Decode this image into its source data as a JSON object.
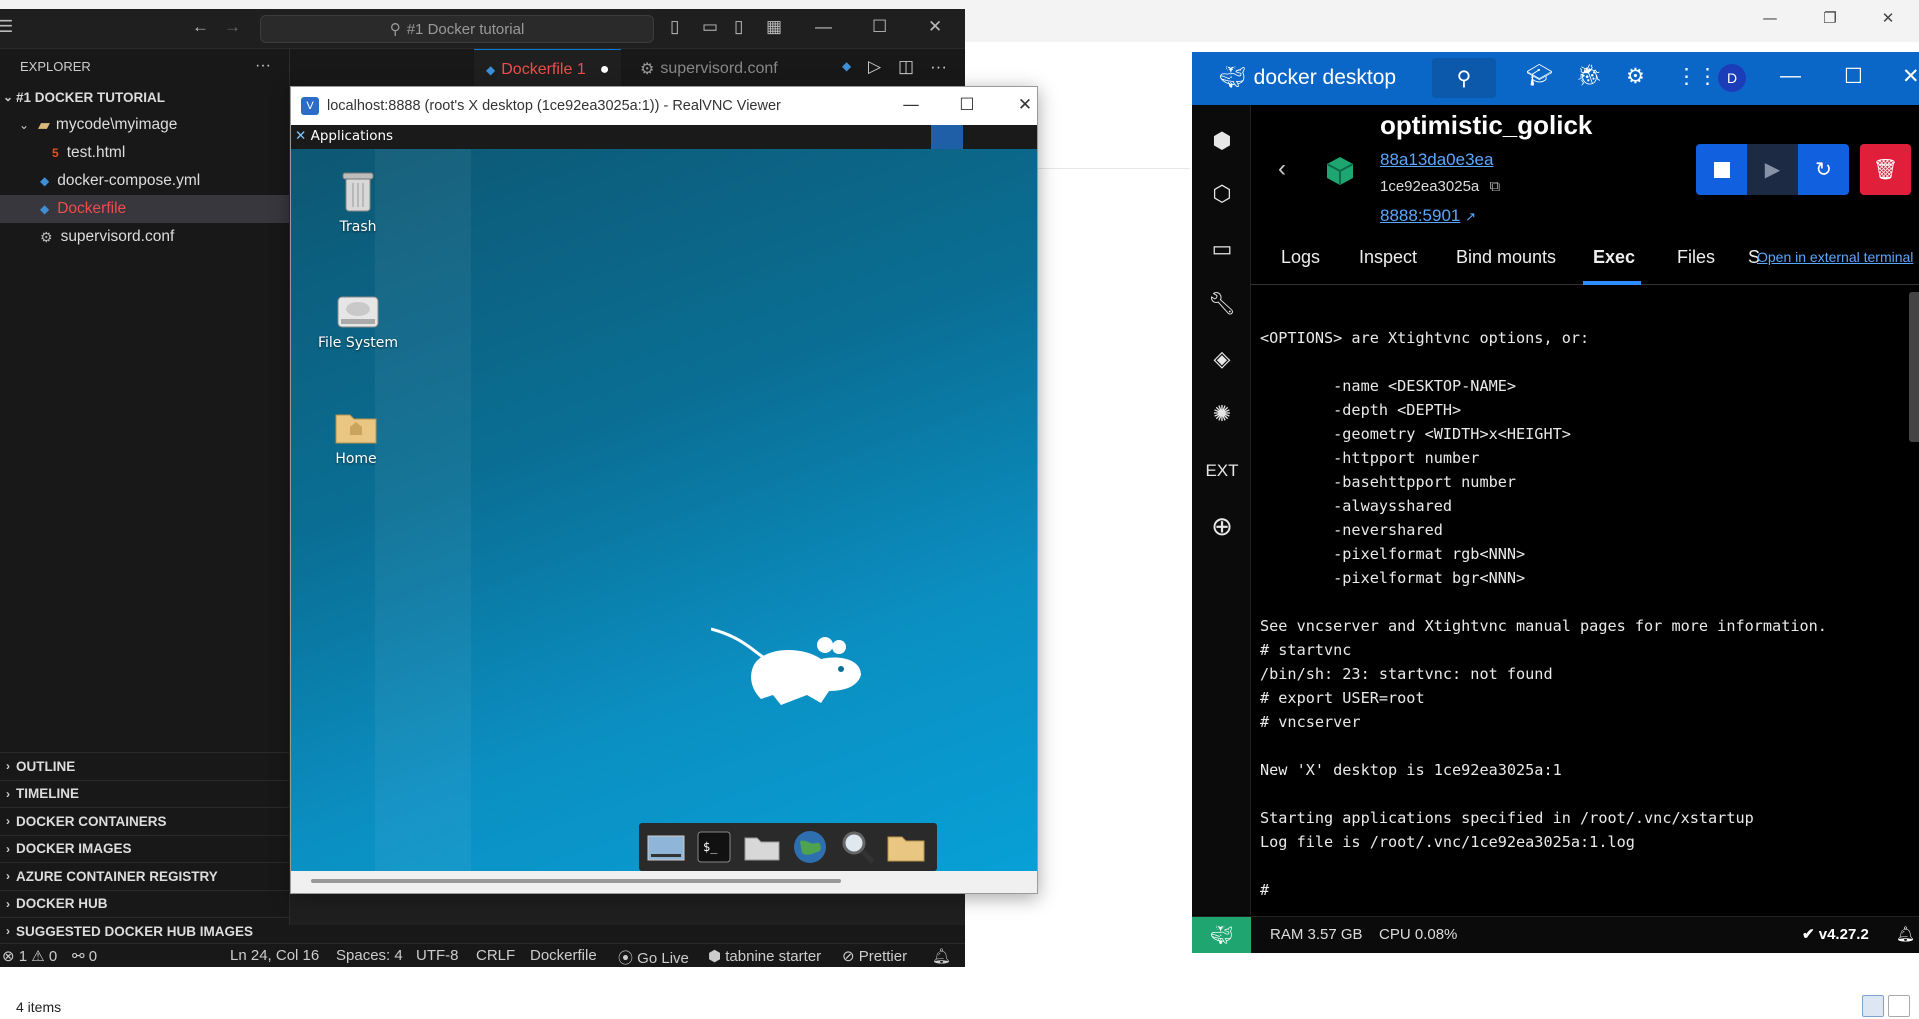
{
  "explorer_bg": {
    "status": "4 items"
  },
  "vscode": {
    "search_placeholder": "#1 Docker tutorial",
    "sidebar_title": "EXPLORER",
    "more": "···",
    "workspace": "#1 DOCKER TUTORIAL",
    "tree": [
      {
        "label": "mycode\\myimage",
        "kind": "folder"
      },
      {
        "label": "test.html",
        "kind": "html"
      },
      {
        "label": "docker-compose.yml",
        "kind": "docker"
      },
      {
        "label": "Dockerfile",
        "kind": "docker"
      },
      {
        "label": "supervisord.conf",
        "kind": "gear"
      }
    ],
    "sections": [
      "OUTLINE",
      "TIMELINE",
      "DOCKER CONTAINERS",
      "DOCKER IMAGES",
      "AZURE CONTAINER REGISTRY",
      "DOCKER HUB",
      "SUGGESTED DOCKER HUB IMAGES"
    ],
    "tabs": [
      {
        "label": "Dockerfile 1"
      },
      {
        "label": "supervisord.conf"
      }
    ],
    "status": {
      "errors": "1",
      "warnings": "0",
      "ports": "0",
      "position": "Ln 24, Col 16",
      "spaces": "Spaces: 4",
      "encoding": "UTF-8",
      "eol": "CRLF",
      "language": "Dockerfile",
      "golive": "Go Live",
      "tabnine": "tabnine starter",
      "prettier": "Prettier"
    }
  },
  "vnc": {
    "title": "localhost:8888 (root's X desktop (1ce92ea3025a:1)) - RealVNC Viewer",
    "applications": "Applications",
    "desktop_icons": [
      "Trash",
      "File System",
      "Home"
    ]
  },
  "docker": {
    "brand": "docker desktop",
    "avatar": "D",
    "ext": "EXT",
    "container_name": "optimistic_golick",
    "image_link": "88a13da0e3ea",
    "container_id": "1ce92ea3025a",
    "port_link": "8888:5901",
    "tabs": [
      "Logs",
      "Inspect",
      "Bind mounts",
      "Exec",
      "Files",
      "S"
    ],
    "external_link": "Open in external terminal",
    "terminal_lines": [
      "<OPTIONS> are Xtightvnc options, or:",
      "",
      "        -name <DESKTOP-NAME>",
      "        -depth <DEPTH>",
      "        -geometry <WIDTH>x<HEIGHT>",
      "        -httpport number",
      "        -basehttpport number",
      "        -alwaysshared",
      "        -nevershared",
      "        -pixelformat rgb<NNN>",
      "        -pixelformat bgr<NNN>",
      "",
      "See vncserver and Xtightvnc manual pages for more information.",
      "# startvnc",
      "/bin/sh: 23: startvnc: not found",
      "# export USER=root",
      "# vncserver",
      "",
      "New 'X' desktop is 1ce92ea3025a:1",
      "",
      "Starting applications specified in /root/.vnc/xstartup",
      "Log file is /root/.vnc/1ce92ea3025a:1.log",
      "",
      "#"
    ],
    "footer": {
      "ram": "RAM 3.57 GB",
      "cpu": "CPU 0.08%",
      "version": "v4.27.2"
    }
  },
  "colors": {
    "vscode_bg": "#181818",
    "docker_blue": "#0a67c7",
    "docker_green": "#1fa56f",
    "delete_red": "#e0203a",
    "selected_file": "#f14c4c",
    "link": "#5aa7ff"
  }
}
